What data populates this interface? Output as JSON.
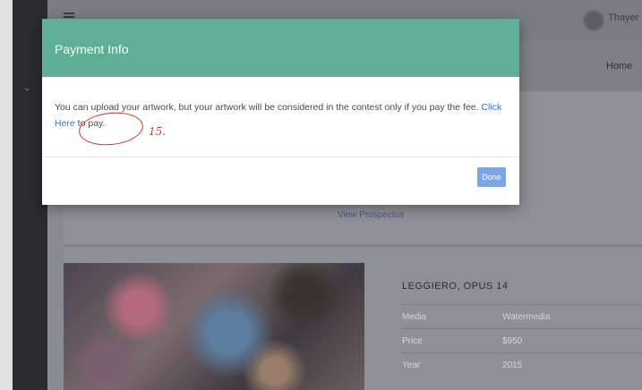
{
  "topbar": {
    "user_name": "Thayer I"
  },
  "navbar": {
    "home_label": "Home"
  },
  "main": {
    "prospectus_link": "View Prospectus",
    "artwork": {
      "title": "LEGGIERO, OPUS 14",
      "details": [
        {
          "label": "Media",
          "value": "Watermedia"
        },
        {
          "label": "Price",
          "value": "$950"
        },
        {
          "label": "Year",
          "value": "2015"
        }
      ]
    }
  },
  "modal": {
    "title": "Payment Info",
    "body_prefix": "You can upload your artwork, but your artwork will be considered in the contest only if you pay the fee. ",
    "link_text": "Click Here",
    "body_suffix": " to pay.",
    "done_label": "Done",
    "annotation": "15."
  },
  "colors": {
    "modal_header": "#5fae96",
    "link": "#3f6fc2",
    "done_button": "#7da6e6",
    "annotation": "#d23a2e"
  }
}
